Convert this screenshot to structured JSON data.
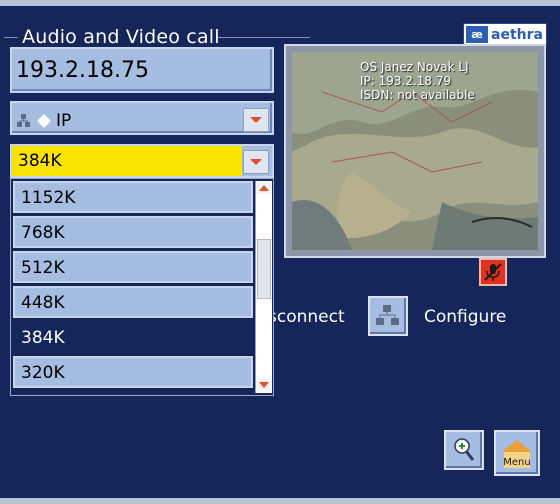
{
  "window": {
    "title": "Audio and Video call"
  },
  "brand": {
    "logo_mark": "æ",
    "logo_word": "aethra"
  },
  "call": {
    "address_value": "193.2.18.75",
    "network_value": "IP",
    "network_icon": "network-icon",
    "rate_selected": "384K"
  },
  "rate_list": {
    "items": [
      "1152K",
      "768K",
      "512K",
      "448K",
      "384K",
      "320K"
    ],
    "highlighted": "384K"
  },
  "video": {
    "name": "OS Janez Novak LJ",
    "ip": "IP: 193.2.18.79",
    "isdn": "ISDN: not available"
  },
  "actions": {
    "disconnect_label": "sconnect",
    "configure_label": "Configure",
    "menu_label": "Menu"
  },
  "colors": {
    "background": "#14265a",
    "field": "#a5bde0",
    "selected": "#fbe300",
    "accent": "#e0502a"
  }
}
